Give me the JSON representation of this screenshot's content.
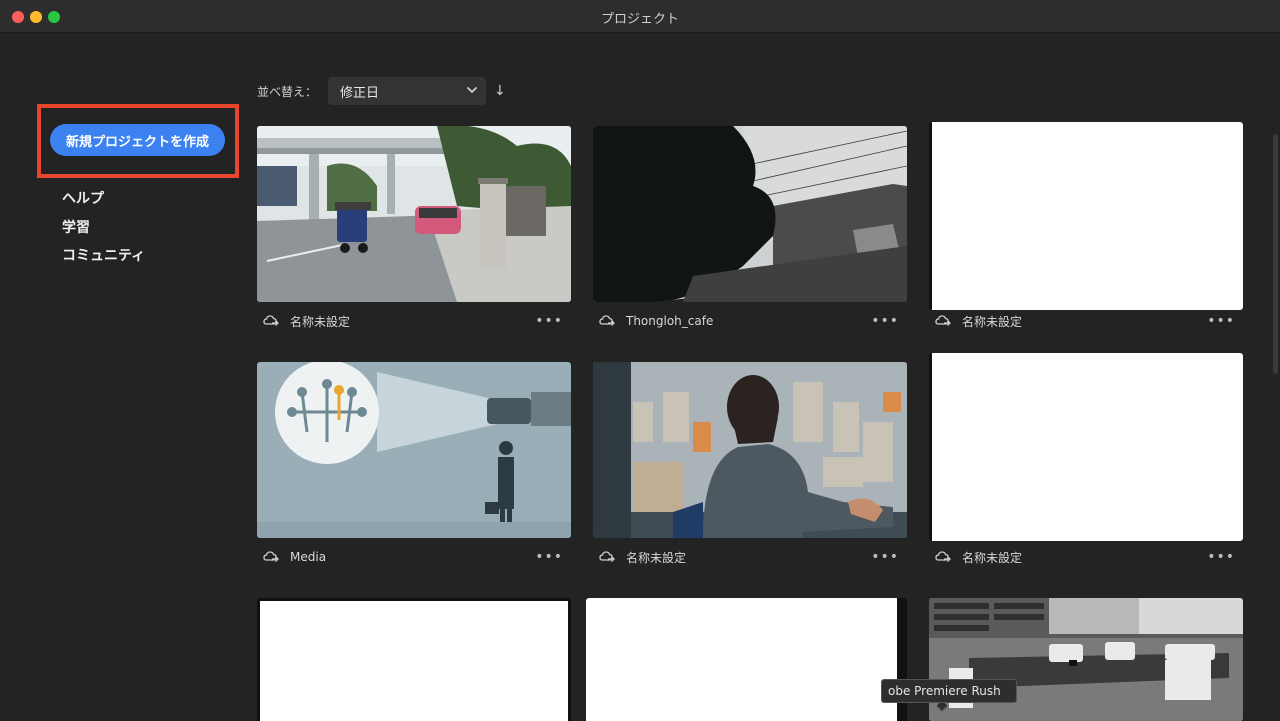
{
  "window": {
    "title": "プロジェクト"
  },
  "sidebar": {
    "new_project_label": "新規プロジェクトを作成",
    "links": [
      {
        "label": "ヘルプ"
      },
      {
        "label": "学習"
      },
      {
        "label": "コミュニティ"
      }
    ]
  },
  "sort": {
    "label": "並べ替え：",
    "selected": "修正日",
    "direction_icon": "↓"
  },
  "projects": [
    {
      "title": "名称未設定",
      "thumbnail": "street-scene"
    },
    {
      "title": "Thongloh_cafe",
      "thumbnail": "tree-silhouette"
    },
    {
      "title": "名称未設定",
      "thumbnail": "blank-white"
    },
    {
      "title": "Media",
      "thumbnail": "keys-illustration"
    },
    {
      "title": "名称未設定",
      "thumbnail": "man-window-city"
    },
    {
      "title": "名称未設定",
      "thumbnail": "blank-white"
    },
    {
      "title": "",
      "thumbnail": "blank-white"
    },
    {
      "title": "",
      "thumbnail": "blank-white"
    },
    {
      "title": "",
      "thumbnail": "cafe-monochrome"
    }
  ],
  "tooltip": {
    "text": "obe Premiere Rush"
  },
  "more_icon": "•••",
  "colors": {
    "accent": "#3b82f0",
    "highlight": "#e8452c",
    "background": "#232323"
  }
}
